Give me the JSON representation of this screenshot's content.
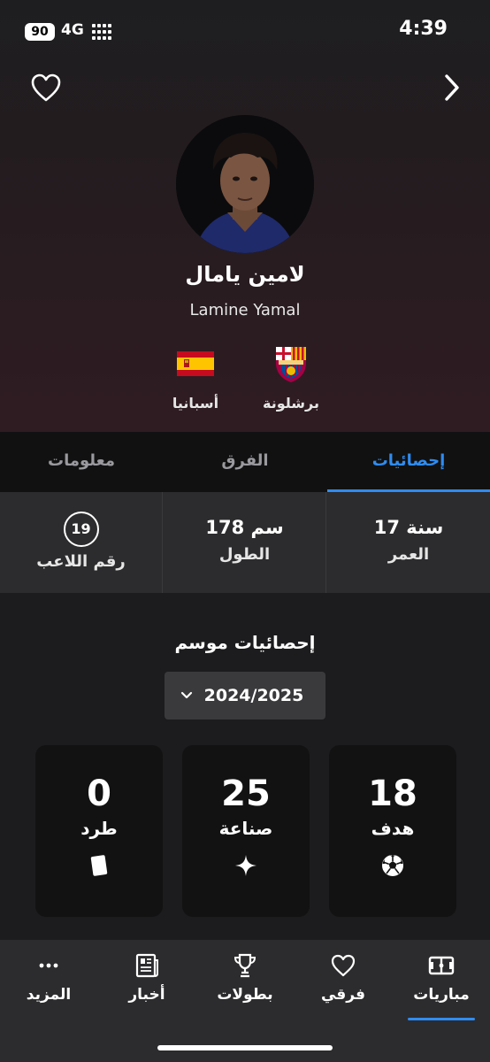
{
  "status_bar": {
    "battery": "90",
    "network": "4G",
    "time": "4:39"
  },
  "player": {
    "name_ar": "لامين يامال",
    "name_en": "Lamine Yamal",
    "club": {
      "name": "برشلونة",
      "logo": "fc-barcelona-crest"
    },
    "nation": {
      "name": "أسبانيا",
      "flag": "spain-flag"
    }
  },
  "tabs": [
    {
      "label": "إحصائيات",
      "active": true
    },
    {
      "label": "الفرق",
      "active": false
    },
    {
      "label": "معلومات",
      "active": false
    }
  ],
  "info": {
    "age": {
      "value": "17 سنة",
      "label": "العمر"
    },
    "height": {
      "value": "178 سم",
      "label": "الطول"
    },
    "number": {
      "value": "19",
      "label": "رقم اللاعب"
    }
  },
  "season": {
    "title": "إحصائيات موسم",
    "selected": "2024/2025"
  },
  "stats": [
    {
      "value": "18",
      "label": "هدف",
      "icon": "soccer-ball-icon"
    },
    {
      "value": "25",
      "label": "صناعة",
      "icon": "sparkle-icon"
    },
    {
      "value": "0",
      "label": "طرد",
      "icon": "red-card-icon"
    }
  ],
  "nav": [
    {
      "label": "مباريات",
      "icon": "pitch-icon",
      "active": true
    },
    {
      "label": "فرقي",
      "icon": "heart-icon",
      "active": false
    },
    {
      "label": "بطولات",
      "icon": "trophy-icon",
      "active": false
    },
    {
      "label": "أخبار",
      "icon": "newspaper-icon",
      "active": false
    },
    {
      "label": "المزيد",
      "icon": "more-icon",
      "active": false
    }
  ],
  "colors": {
    "accent": "#2f8cf1",
    "background": "#1c1c1e",
    "card": "#121213"
  }
}
